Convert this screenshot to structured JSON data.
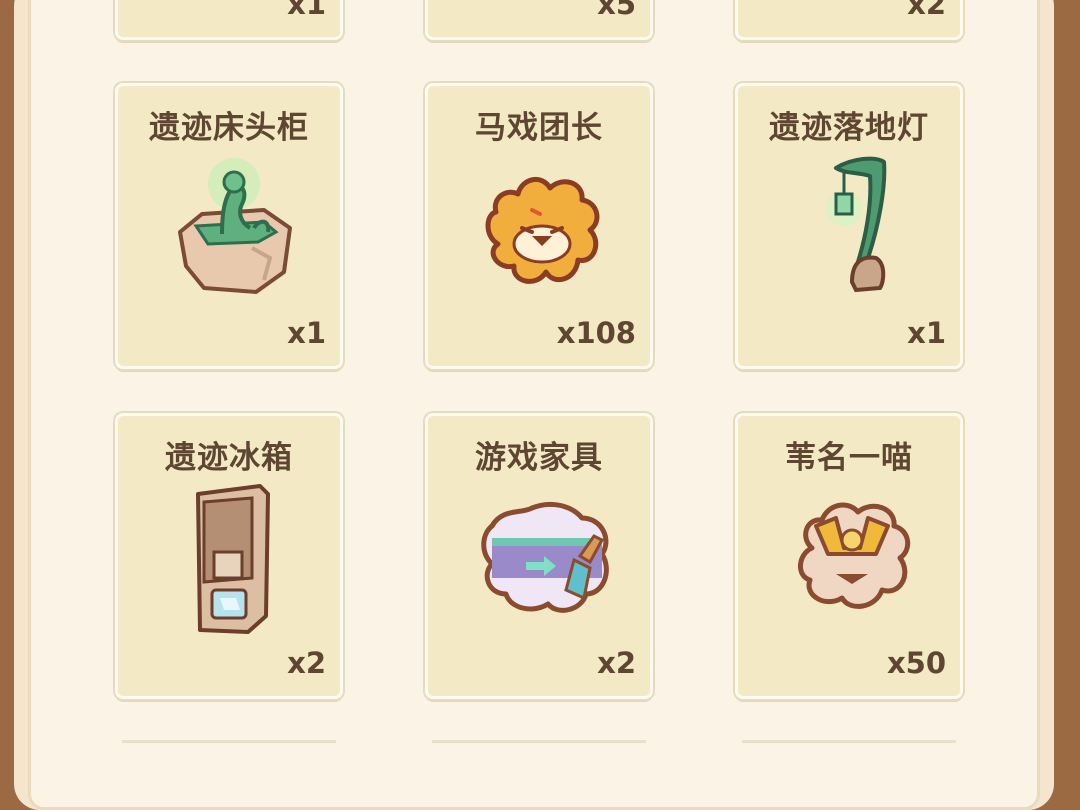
{
  "items_partial_top": [
    {
      "qty": "x1"
    },
    {
      "qty": "x5"
    },
    {
      "qty": "x2"
    }
  ],
  "items": [
    {
      "name": "遗迹床头柜",
      "qty": "x1",
      "icon": "ruin-nightstand-icon"
    },
    {
      "name": "马戏团长",
      "qty": "x108",
      "icon": "lion-puzzle-piece-icon"
    },
    {
      "name": "遗迹落地灯",
      "qty": "x1",
      "icon": "ruin-floor-lamp-icon"
    },
    {
      "name": "遗迹冰箱",
      "qty": "x2",
      "icon": "ruin-fridge-icon"
    },
    {
      "name": "游戏家具",
      "qty": "x2",
      "icon": "furniture-paint-puzzle-icon"
    },
    {
      "name": "苇名一喵",
      "qty": "x50",
      "icon": "samurai-cat-puzzle-icon"
    }
  ],
  "colors": {
    "accent_text": "#5e4632",
    "card_bg": "#f3e9c4",
    "frame": "#9b6a43"
  }
}
